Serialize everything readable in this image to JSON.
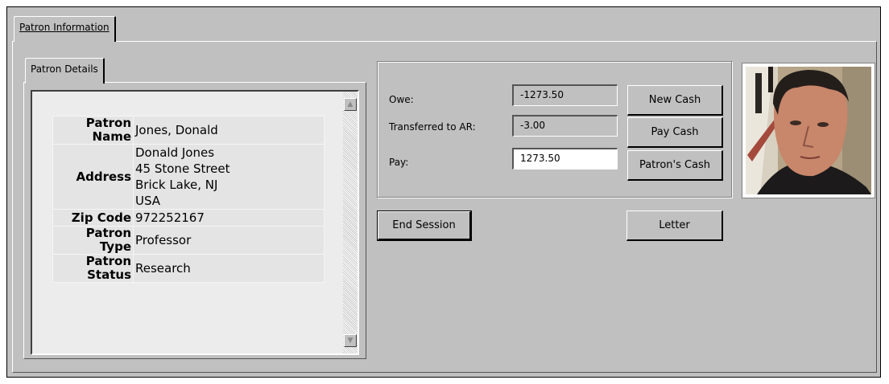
{
  "tabs": {
    "main": {
      "label": "Patron Information"
    },
    "details": {
      "label": "Patron Details"
    }
  },
  "patron_details": [
    {
      "label": "Patron Name",
      "value": "Jones, Donald"
    },
    {
      "label": "Address",
      "value": "Donald Jones\n45 Stone Street\nBrick Lake, NJ\nUSA"
    },
    {
      "label": "Zip Code",
      "value": "972252167"
    },
    {
      "label": "Patron Type",
      "value": "Professor"
    },
    {
      "label": "Patron Status",
      "value": "Research"
    }
  ],
  "cash": {
    "owe_label": "Owe:",
    "owe_value": "-1273.50",
    "transferred_label": "Transferred to AR:",
    "transferred_value": "-3.00",
    "pay_label": "Pay:",
    "pay_value": "1273.50"
  },
  "buttons": {
    "new_cash": "New Cash",
    "pay_cash": "Pay Cash",
    "patrons_cash": "Patron's Cash",
    "end_session": "End Session",
    "letter": "Letter"
  },
  "icons": {
    "scroll_up": "scroll-up-arrow",
    "scroll_down": "scroll-down-arrow"
  },
  "colors": {
    "window_bg": "#c0c0c0",
    "input_bg": "#ffffff"
  }
}
